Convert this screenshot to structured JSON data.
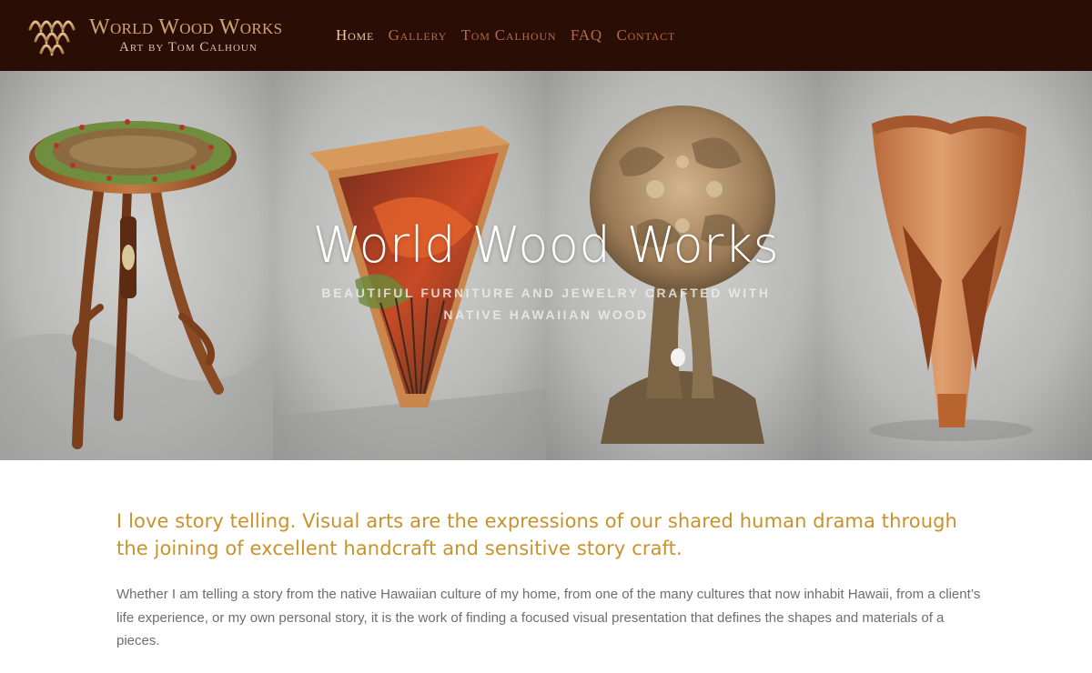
{
  "header": {
    "logo_title": "World Wood Works",
    "logo_subtitle": "Art by Tom Calhoun",
    "logo_icon": "wave-arches-icon",
    "nav": [
      {
        "label": "Home",
        "active": true
      },
      {
        "label": "Gallery",
        "active": false
      },
      {
        "label": "Tom Calhoun",
        "active": false
      },
      {
        "label": "FAQ",
        "active": false
      },
      {
        "label": "Contact",
        "active": false
      }
    ]
  },
  "hero": {
    "title": "World Wood Works",
    "subtitle": "BEAUTIFUL FURNITURE AND JEWELRY CRAFTED WITH NATIVE HAWAIIAN WOOD",
    "panels": [
      "side-table-photo",
      "wall-table-photo",
      "carved-sphere-photo",
      "wooden-vase-photo"
    ]
  },
  "content": {
    "lead": "I love story telling. Visual arts are the expressions of our shared human drama through the joining of excellent handcraft and sensitive story craft.",
    "body": "Whether I am telling a story from the native Hawaiian culture of my home, from one of the many cultures that now inhabit Hawaii, from a client’s life experience, or my own personal story, it is the work of finding a focused visual presentation that defines the shapes and materials of a pieces."
  },
  "colors": {
    "header_bg": "#2a0d05",
    "nav_link": "#b26b49",
    "nav_active": "#f0c7a4",
    "logo_gold": "#cfa473",
    "lead_text": "#c8922c",
    "body_text": "#6e6e6e"
  }
}
